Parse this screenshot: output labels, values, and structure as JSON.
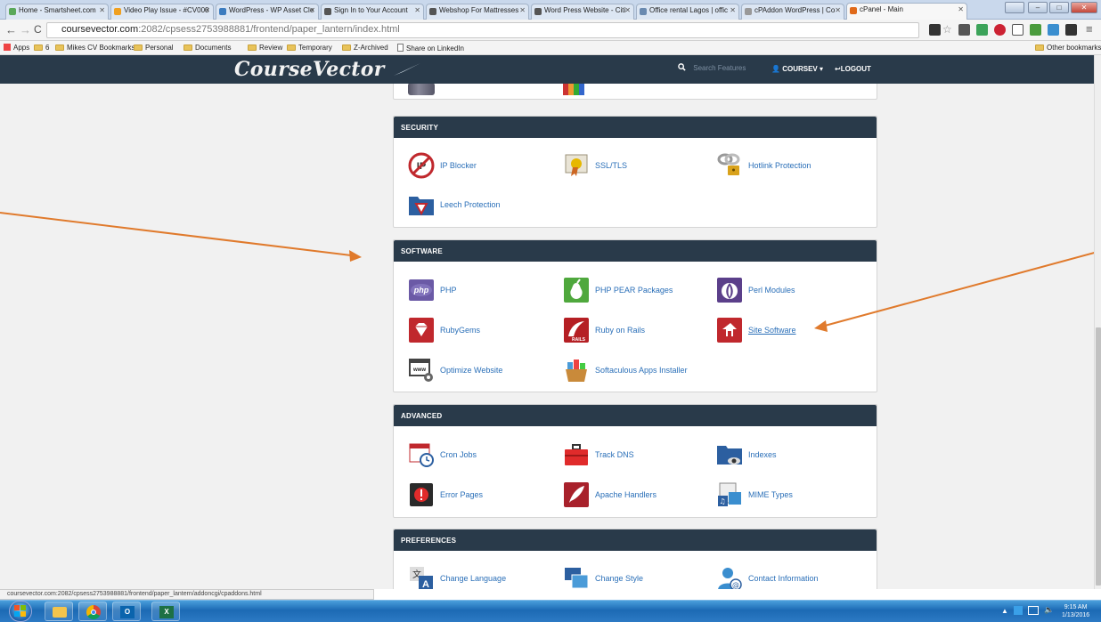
{
  "browser": {
    "tabs": [
      {
        "label": "Home - Smartsheet.com",
        "color": "#5aa85a"
      },
      {
        "label": "Video Play Issue - #CV000",
        "color": "#f0a020"
      },
      {
        "label": "WordPress - WP Asset Cle",
        "color": "#3c7cbf"
      },
      {
        "label": "Sign In to Your Account",
        "color": "#555555"
      },
      {
        "label": "Webshop For Mattresses",
        "color": "#555555"
      },
      {
        "label": "Word Press Website - Citi",
        "color": "#555555"
      },
      {
        "label": "Office rental Lagos | offic",
        "color": "#6a8ab0"
      },
      {
        "label": "cPAddon WordPress | Co",
        "color": "#999999"
      },
      {
        "label": "cPanel - Main",
        "color": "#e06a1a"
      }
    ],
    "url_host": "coursevector.com",
    "url_path": ":2082/cpsess2753988881/frontend/paper_lantern/index.html",
    "bookmarks": [
      "Apps",
      "6",
      "Mikes CV Bookmarks",
      "Personal",
      "Documents",
      "Review",
      "Temporary",
      "Z-Archived",
      "Share on LinkedIn"
    ],
    "other_bookmarks": "Other bookmarks",
    "status_url": "coursevector.com:2082/cpsess2753988881/frontend/paper_lantern/addoncgi/cpaddons.html"
  },
  "header": {
    "logo": "CourseVector",
    "search_placeholder": "Search Features",
    "user": "COURSEV",
    "logout": "LOGOUT"
  },
  "sections": [
    {
      "title": "SECURITY",
      "items": [
        {
          "label": "IP Blocker",
          "icon": "ip-blocker-icon"
        },
        {
          "label": "SSL/TLS",
          "icon": "ssl-certificate-icon"
        },
        {
          "label": "Hotlink Protection",
          "icon": "hotlink-lock-icon"
        },
        {
          "label": "Leech Protection",
          "icon": "leech-folder-icon"
        }
      ]
    },
    {
      "title": "SOFTWARE",
      "items": [
        {
          "label": "PHP",
          "icon": "php-icon"
        },
        {
          "label": "PHP PEAR Packages",
          "icon": "pear-icon"
        },
        {
          "label": "Perl Modules",
          "icon": "perl-onion-icon"
        },
        {
          "label": "RubyGems",
          "icon": "ruby-gem-icon"
        },
        {
          "label": "Ruby on Rails",
          "icon": "rails-icon"
        },
        {
          "label": "Site Software",
          "icon": "site-software-icon"
        },
        {
          "label": "Optimize Website",
          "icon": "optimize-website-icon"
        },
        {
          "label": "Softaculous Apps Installer",
          "icon": "softaculous-icon"
        }
      ]
    },
    {
      "title": "ADVANCED",
      "items": [
        {
          "label": "Cron Jobs",
          "icon": "cron-calendar-icon"
        },
        {
          "label": "Track DNS",
          "icon": "track-dns-toolbox-icon"
        },
        {
          "label": "Indexes",
          "icon": "indexes-folder-eye-icon"
        },
        {
          "label": "Error Pages",
          "icon": "error-pages-icon"
        },
        {
          "label": "Apache Handlers",
          "icon": "apache-feather-icon"
        },
        {
          "label": "MIME Types",
          "icon": "mime-types-icon"
        }
      ]
    },
    {
      "title": "PREFERENCES",
      "items": [
        {
          "label": "Change Language",
          "icon": "change-language-icon"
        },
        {
          "label": "Change Style",
          "icon": "change-style-icon"
        },
        {
          "label": "Contact Information",
          "icon": "contact-information-icon"
        }
      ]
    }
  ],
  "taskbar": {
    "time": "9:15 AM",
    "date": "1/13/2016"
  },
  "colors": {
    "header_bg": "#293a4a",
    "link_blue": "#2a6fb8",
    "annotation_arrow": "#e07a2c"
  }
}
